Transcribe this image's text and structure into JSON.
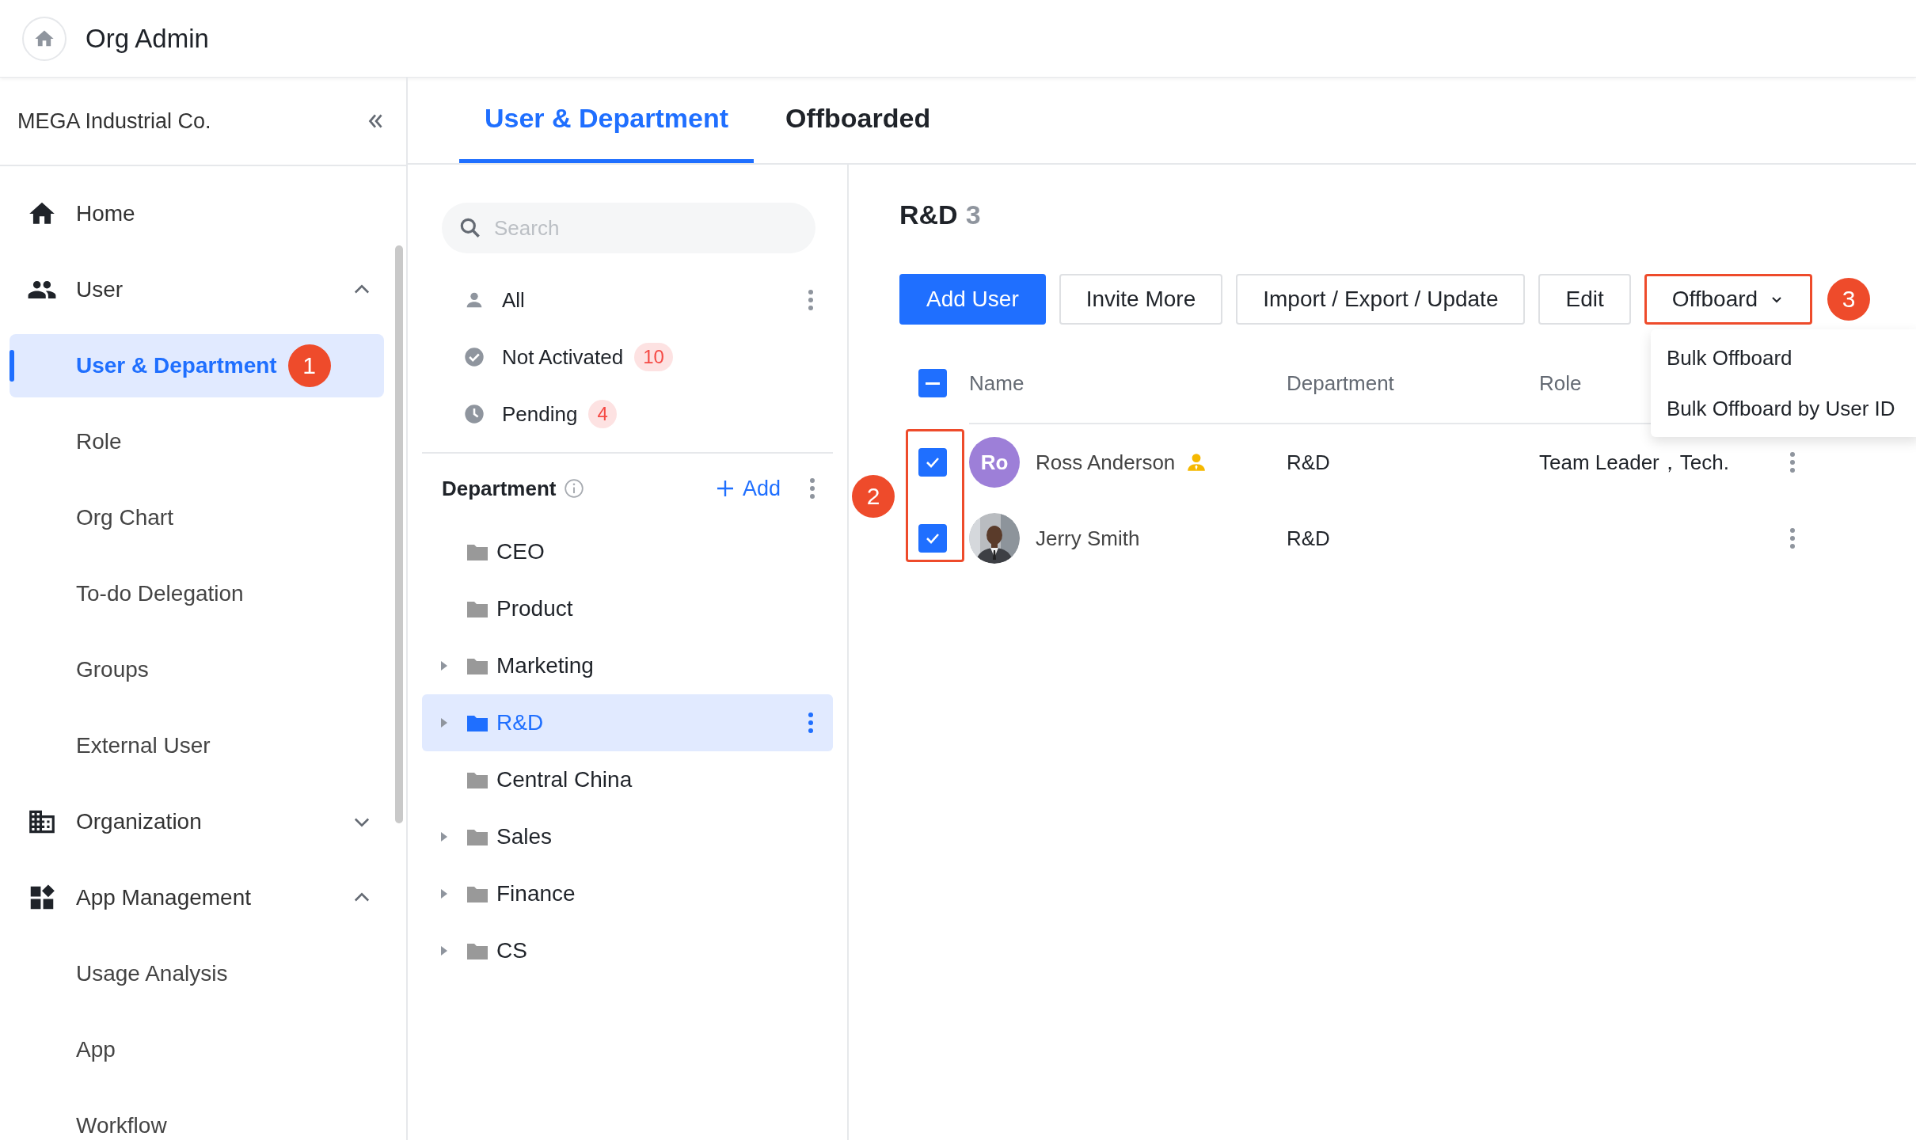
{
  "header": {
    "title": "Org Admin"
  },
  "sidebar": {
    "org_name": "MEGA Industrial Co.",
    "sections": [
      {
        "label": "Home"
      },
      {
        "label": "User",
        "expanded": true,
        "children": [
          {
            "label": "User & Department",
            "selected": true,
            "badge": "1"
          },
          {
            "label": "Role",
            "selected": false
          },
          {
            "label": "Org Chart",
            "selected": false
          },
          {
            "label": "To-do Delegation",
            "selected": false
          },
          {
            "label": "Groups",
            "selected": false
          },
          {
            "label": "External User",
            "selected": false
          }
        ]
      },
      {
        "label": "Organization",
        "expanded": false
      },
      {
        "label": "App Management",
        "expanded": true,
        "children": [
          {
            "label": "Usage Analysis",
            "selected": false
          },
          {
            "label": "App",
            "selected": false
          },
          {
            "label": "Workflow",
            "selected": false
          }
        ]
      }
    ]
  },
  "tabs": [
    {
      "label": "User & Department",
      "selected": true
    },
    {
      "label": "Offboarded",
      "selected": false
    }
  ],
  "user_filter": {
    "search": {
      "placeholder": "Search"
    },
    "items": [
      {
        "label": "All"
      },
      {
        "label": "Not Activated",
        "count": "10"
      },
      {
        "label": "Pending",
        "count": "4"
      }
    ]
  },
  "department": {
    "title": "Department",
    "add_label": "Add",
    "items": [
      {
        "label": "CEO",
        "has_children": false,
        "selected": false
      },
      {
        "label": "Product",
        "has_children": false,
        "selected": false
      },
      {
        "label": "Marketing",
        "has_children": true,
        "selected": false
      },
      {
        "label": "R&D",
        "has_children": true,
        "selected": true
      },
      {
        "label": "Central China",
        "has_children": false,
        "selected": false
      },
      {
        "label": "Sales",
        "has_children": true,
        "selected": false
      },
      {
        "label": "Finance",
        "has_children": true,
        "selected": false
      },
      {
        "label": "CS",
        "has_children": true,
        "selected": false
      }
    ]
  },
  "content": {
    "title": "R&D",
    "count": "3",
    "buttons": [
      {
        "label": "Add User",
        "kind": "primary"
      },
      {
        "label": "Invite More",
        "kind": "default"
      },
      {
        "label": "Import / Export / Update",
        "kind": "default"
      },
      {
        "label": "Edit",
        "kind": "default"
      },
      {
        "label": "Offboard",
        "kind": "dropdown",
        "highlighted": true,
        "badge": "3"
      }
    ],
    "dropdown": {
      "items": [
        "Bulk Offboard",
        "Bulk Offboard by User ID"
      ]
    },
    "table": {
      "columns": [
        "Name",
        "Department",
        "Role"
      ],
      "header_partial": true,
      "selection_highlighted": true,
      "selection_badge": "2",
      "rows": [
        {
          "kind": "initials",
          "initials": "Ro",
          "name": "Ross Anderson",
          "leader": true,
          "department": "R&D",
          "role": "Team Leader，Tech.",
          "checked": true
        },
        {
          "kind": "picture",
          "name": "Jerry Smith",
          "leader": false,
          "department": "R&D",
          "checked": true
        }
      ]
    }
  }
}
